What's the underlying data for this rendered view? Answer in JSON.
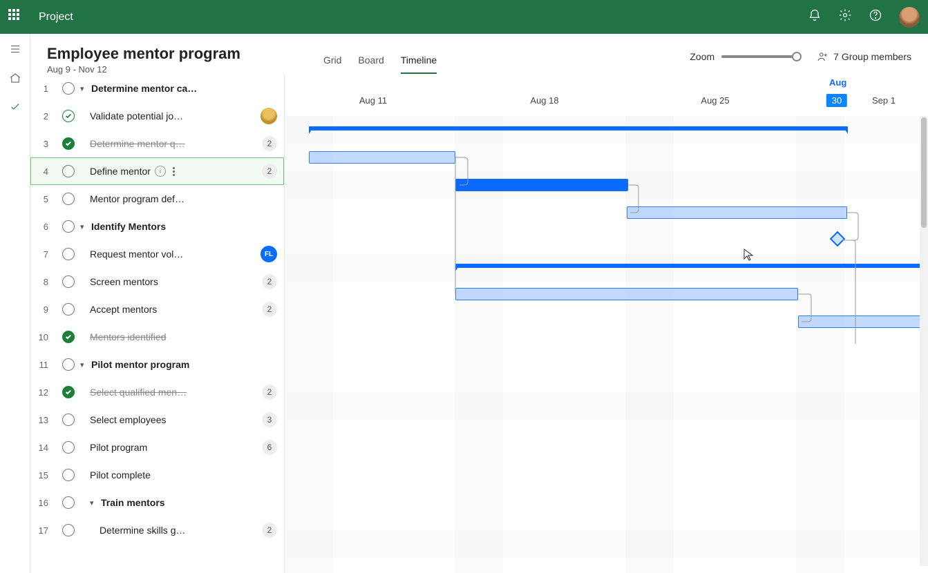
{
  "app_name": "Project",
  "page_title": "Employee mentor program",
  "date_range": "Aug 9 - Nov 12",
  "tabs": {
    "grid": "Grid",
    "board": "Board",
    "timeline": "Timeline"
  },
  "zoom_label": "Zoom",
  "members_label": "7 Group members",
  "timeline_header": {
    "month": "Aug",
    "dates": [
      "Aug 11",
      "Aug 18",
      "Aug 25",
      "30",
      "Sep 1"
    ]
  },
  "tasks": [
    {
      "n": "1",
      "name": "Determine mentor ca…",
      "status": "open",
      "summary": true
    },
    {
      "n": "2",
      "name": "Validate potential jo…",
      "status": "progress",
      "avatar": "yellow"
    },
    {
      "n": "3",
      "name": "Determine mentor q…",
      "status": "done",
      "badge": "2"
    },
    {
      "n": "4",
      "name": "Define mentor",
      "status": "open",
      "badge": "2",
      "selected": true
    },
    {
      "n": "5",
      "name": "Mentor program def…",
      "status": "open"
    },
    {
      "n": "6",
      "name": "Identify Mentors",
      "status": "open",
      "summary": true
    },
    {
      "n": "7",
      "name": "Request mentor vol…",
      "status": "open",
      "avatar": "FL"
    },
    {
      "n": "8",
      "name": "Screen mentors",
      "status": "open",
      "badge": "2"
    },
    {
      "n": "9",
      "name": "Accept mentors",
      "status": "open",
      "badge": "2"
    },
    {
      "n": "10",
      "name": "Mentors identified",
      "status": "done"
    },
    {
      "n": "11",
      "name": "Pilot mentor program",
      "status": "open",
      "summary": true
    },
    {
      "n": "12",
      "name": "Select qualified men…",
      "status": "done",
      "badge": "2"
    },
    {
      "n": "13",
      "name": "Select employees",
      "status": "open",
      "badge": "3"
    },
    {
      "n": "14",
      "name": "Pilot program",
      "status": "open",
      "badge": "6"
    },
    {
      "n": "15",
      "name": "Pilot complete",
      "status": "open"
    },
    {
      "n": "16",
      "name": "Train mentors",
      "status": "open",
      "summary": true,
      "extra_indent": true
    },
    {
      "n": "17",
      "name": "Determine skills g…",
      "status": "open",
      "badge": "2",
      "extra_indent": true
    }
  ]
}
